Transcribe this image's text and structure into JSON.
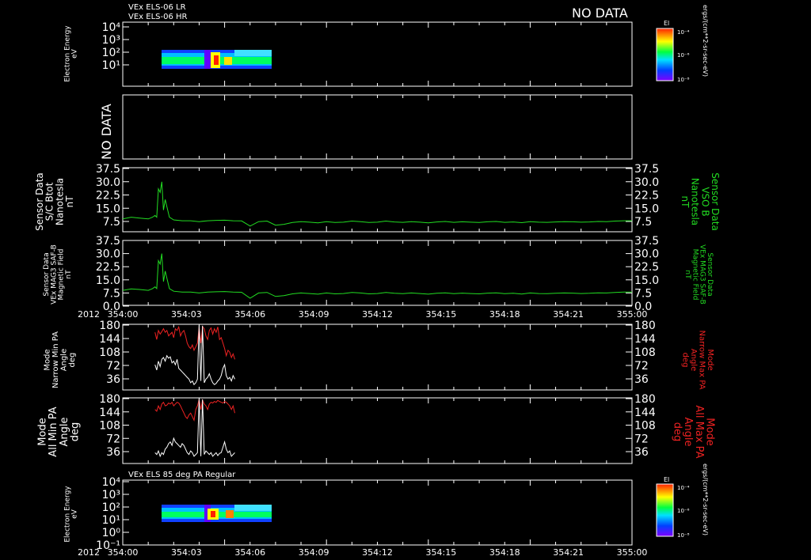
{
  "header": {
    "line1": "VEx ELS-06 LR",
    "line2": "VEx ELS-06 HR",
    "no_data": "NO DATA"
  },
  "colors": {
    "background": "#000000",
    "axes": "#ffffff",
    "green_trace": "#22dd22",
    "red_trace": "#ee2222",
    "white_trace": "#ffffff",
    "label_green": "#22dd22",
    "label_red": "#ee2222"
  },
  "time_axis": {
    "start": "354:00",
    "end": "355:00",
    "ticks": [
      "354:00",
      "354:03",
      "354:06",
      "354:09",
      "354:12",
      "354:15",
      "354:18",
      "354:21",
      "355:00"
    ],
    "year_label": "2012"
  },
  "panels": {
    "p1": {
      "ylabel": [
        "Electron Energy",
        "eV"
      ],
      "yticks": [
        "10⁴",
        "10³",
        "10²",
        "10¹"
      ],
      "colorbar_title": "El",
      "colorbar_ticks": [
        "10⁻⁴",
        "10⁻⁶",
        "10⁻⁸"
      ],
      "colorbar_units": "ergs/(cm**2-sr-sec-eV)"
    },
    "p2": {
      "no_data": "NO DATA"
    },
    "p3": {
      "left_label": [
        "Sensor Data",
        "S/C Btot",
        "Nanotesla",
        "nT"
      ],
      "right_label": [
        "Sensor Data",
        "VSO B",
        "Nanotesla",
        "nT"
      ],
      "yticks": [
        "37.5",
        "30.0",
        "22.5",
        "15.0",
        "7.5"
      ]
    },
    "p4": {
      "left_label": [
        "Sensor Data",
        "VEx MAG3 SAF-B",
        "Magnetic Field",
        "nT"
      ],
      "right_label": [
        "Sensor Data",
        "VEx MAG3 SAF-B",
        "Magnetic Field",
        "nT"
      ],
      "yticks": [
        "37.5",
        "30.0",
        "22.5",
        "15.0",
        "7.5",
        "0.0"
      ]
    },
    "p5": {
      "left_label": [
        "Mode",
        "Narrow Min PA",
        "Angle",
        "deg"
      ],
      "right_label": [
        "Mode",
        "Narrow Max PA",
        "Angle",
        "deg"
      ],
      "yticks": [
        "180",
        "144",
        "108",
        "72",
        "36"
      ]
    },
    "p6": {
      "left_label": [
        "Mode",
        "All Min PA",
        "Angle",
        "deg"
      ],
      "right_label": [
        "Mode",
        "All Max PA",
        "Angle",
        "deg"
      ],
      "yticks": [
        "180",
        "144",
        "108",
        "72",
        "36"
      ]
    },
    "p7": {
      "title": "VEx ELS 85 deg PA Regular",
      "ylabel": [
        "Electron Energy",
        "eV"
      ],
      "yticks": [
        "10⁴",
        "10³",
        "10²",
        "10¹",
        "10⁰",
        "10⁻¹"
      ],
      "colorbar_title": "El",
      "colorbar_ticks": [
        "10⁻⁴",
        "10⁻⁶",
        "10⁻⁸"
      ],
      "colorbar_units": "ergs/(cm**2-sr-sec-eV)"
    }
  },
  "chart_data": [
    {
      "type": "heatmap",
      "title": "VEx ELS-06 LR / VEx ELS-06 HR",
      "ylabel": "Electron Energy eV",
      "yscale": "log",
      "ylim": [
        1,
        10000
      ],
      "xlim": [
        "354:00",
        "355:00"
      ],
      "data_span": [
        "354:01.8",
        "354:06.9"
      ],
      "energy_range": [
        10,
        200
      ],
      "colorbar": {
        "title": "El",
        "scale": "log",
        "range": [
          1e-08,
          0.0001
        ],
        "units": "ergs/(cm**2-sr-sec-eV)"
      }
    },
    {
      "type": "line",
      "no_data": true,
      "label": "NO DATA"
    },
    {
      "type": "line",
      "ylabel": "Sensor Data S/C Btot Nanotesla nT",
      "ylim": [
        0,
        37.5
      ],
      "xlim_minutes": [
        0,
        60
      ],
      "series": [
        {
          "name": "VSO B",
          "color": "#22dd22",
          "x": [
            0,
            1,
            2,
            3,
            3.5,
            3.8,
            4.0,
            4.2,
            4.4,
            4.6,
            4.8,
            5.0,
            5.2,
            5.5,
            6,
            7,
            8,
            9,
            10,
            11,
            12,
            13,
            14,
            15,
            16,
            17,
            18,
            19,
            20,
            21,
            22,
            23,
            24,
            25,
            26,
            27,
            28,
            29,
            30,
            31,
            32,
            33,
            34,
            35,
            36,
            37,
            38,
            39,
            40,
            41,
            42,
            43,
            44,
            45,
            46,
            47,
            48,
            49,
            50,
            51,
            52,
            53,
            54,
            55,
            56,
            57,
            58,
            59,
            60
          ],
          "y": [
            9,
            10,
            9.5,
            9,
            10,
            11,
            10,
            26,
            24,
            30,
            14,
            20,
            16,
            10,
            8.5,
            8,
            8,
            7.5,
            8,
            8.2,
            8.3,
            8,
            7.9,
            5,
            7.5,
            7.8,
            5.5,
            6,
            7,
            7.5,
            7.2,
            6.8,
            7.5,
            7,
            7.2,
            7.8,
            7.5,
            7,
            7.2,
            7.8,
            7.3,
            7.1,
            7.5,
            7.2,
            6.8,
            7.3,
            7.6,
            7.1,
            7.4,
            7.2,
            7,
            7.4,
            7.6,
            7.1,
            7.3,
            6.9,
            7.5,
            7.2,
            7.1,
            7.3,
            7.5,
            7.4,
            7.2,
            7.3,
            7.6,
            7.5,
            7.8,
            8,
            8
          ]
        }
      ]
    },
    {
      "type": "line",
      "ylabel": "Sensor Data VEx MAG3 SAF-B Magnetic Field nT",
      "ylim": [
        0,
        37.5
      ],
      "xlim_minutes": [
        0,
        60
      ],
      "series": [
        {
          "name": "VEx MAG3 SAF-B",
          "color": "#22dd22",
          "x": [
            0,
            1,
            2,
            3,
            3.5,
            3.8,
            4.0,
            4.2,
            4.4,
            4.6,
            4.8,
            5.0,
            5.2,
            5.5,
            6,
            7,
            8,
            9,
            10,
            11,
            12,
            13,
            14,
            15,
            16,
            17,
            18,
            19,
            20,
            21,
            22,
            23,
            24,
            25,
            26,
            27,
            28,
            29,
            30,
            31,
            32,
            33,
            34,
            35,
            36,
            37,
            38,
            39,
            40,
            41,
            42,
            43,
            44,
            45,
            46,
            47,
            48,
            49,
            50,
            51,
            52,
            53,
            54,
            55,
            56,
            57,
            58,
            59,
            60
          ],
          "y": [
            9,
            9.8,
            9.5,
            9,
            10,
            11,
            10,
            26,
            24,
            30,
            14,
            20,
            16,
            10,
            8.5,
            8,
            8,
            7.5,
            8,
            8.2,
            8.3,
            8,
            7.9,
            4.5,
            7.5,
            7.8,
            5.5,
            6,
            7,
            7.5,
            7.2,
            6.8,
            7.5,
            7,
            7.2,
            7.8,
            7.5,
            7,
            7.2,
            7.8,
            7.3,
            7.1,
            7.5,
            7.2,
            6.8,
            7.3,
            7.6,
            7.1,
            7.4,
            7.2,
            7,
            7.4,
            7.6,
            7.1,
            7.3,
            6.9,
            7.5,
            7.2,
            7.1,
            7.3,
            7.5,
            7.4,
            7.2,
            7.3,
            7.6,
            7.5,
            7.8,
            8,
            8
          ]
        }
      ]
    },
    {
      "type": "line",
      "ylabel": "Mode Narrow Min PA Angle deg",
      "ylim": [
        0,
        180
      ],
      "xlim_minutes": [
        0,
        60
      ],
      "series": [
        {
          "name": "Narrow Max PA",
          "color": "#ee2222",
          "x": [
            3.8,
            4.0,
            4.2,
            4.4,
            4.6,
            4.8,
            5.0,
            5.2,
            5.4,
            5.6,
            5.8,
            6.0,
            6.2,
            6.4,
            6.6,
            6.8,
            7.0,
            7.2,
            7.4,
            7.6,
            7.8,
            8.0,
            8.2,
            8.4,
            8.6,
            8.8,
            9.0,
            9.2,
            9.4,
            9.6,
            9.8,
            10.0,
            10.2,
            10.4,
            10.6,
            10.8,
            11.0,
            11.2,
            11.4,
            11.6,
            11.8,
            12.0,
            12.2,
            12.4,
            12.6,
            12.8,
            13.0,
            13.2
          ],
          "y": [
            160,
            140,
            165,
            155,
            162,
            170,
            160,
            165,
            150,
            155,
            160,
            145,
            170,
            165,
            175,
            150,
            160,
            165,
            150,
            130,
            120,
            115,
            125,
            110,
            120,
            130,
            175,
            130,
            176,
            170,
            150,
            140,
            165,
            172,
            155,
            170,
            160,
            175,
            140,
            145,
            130,
            115,
            95,
            110,
            105,
            90,
            100,
            85
          ]
        },
        {
          "name": "Narrow Min PA",
          "color": "#ffffff",
          "x": [
            3.8,
            4.0,
            4.2,
            4.4,
            4.6,
            4.8,
            5.0,
            5.2,
            5.4,
            5.6,
            5.8,
            6.0,
            6.2,
            6.4,
            6.6,
            6.8,
            7.0,
            7.2,
            7.4,
            7.6,
            7.8,
            8.0,
            8.2,
            8.4,
            8.6,
            8.8,
            9.0,
            9.2,
            9.4,
            9.6,
            9.8,
            10.0,
            10.2,
            10.4,
            10.6,
            10.8,
            11.0,
            11.2,
            11.4,
            11.6,
            11.8,
            12.0,
            12.2,
            12.4,
            12.6,
            12.8,
            13.0,
            13.2
          ],
          "y": [
            70,
            55,
            80,
            65,
            85,
            90,
            80,
            95,
            88,
            92,
            75,
            80,
            70,
            85,
            60,
            55,
            50,
            45,
            40,
            35,
            30,
            20,
            25,
            15,
            20,
            30,
            180,
            25,
            178,
            20,
            30,
            35,
            45,
            30,
            20,
            15,
            18,
            25,
            30,
            40,
            60,
            70,
            40,
            30,
            35,
            25,
            40,
            30
          ]
        }
      ]
    },
    {
      "type": "line",
      "ylabel": "Mode All Min PA Angle deg",
      "ylim": [
        0,
        180
      ],
      "xlim_minutes": [
        0,
        60
      ],
      "series": [
        {
          "name": "All Max PA",
          "color": "#ee2222",
          "x": [
            3.8,
            4.0,
            4.2,
            4.4,
            4.6,
            4.8,
            5.0,
            5.2,
            5.4,
            5.6,
            5.8,
            6.0,
            6.2,
            6.4,
            6.6,
            6.8,
            7.0,
            7.2,
            7.4,
            7.6,
            7.8,
            8.0,
            8.2,
            8.4,
            8.6,
            8.8,
            9.0,
            9.2,
            9.4,
            9.6,
            9.8,
            10.0,
            10.2,
            10.4,
            10.6,
            10.8,
            11.0,
            11.2,
            11.4,
            11.6,
            11.8,
            12.0,
            12.2,
            12.4,
            12.6,
            12.8,
            13.0,
            13.2
          ],
          "y": [
            150,
            145,
            160,
            150,
            165,
            170,
            160,
            162,
            168,
            165,
            170,
            160,
            165,
            170,
            168,
            160,
            150,
            140,
            130,
            125,
            135,
            140,
            130,
            120,
            150,
            160,
            178,
            150,
            176,
            165,
            160,
            150,
            165,
            170,
            168,
            172,
            170,
            175,
            172,
            170,
            168,
            172,
            170,
            165,
            160,
            150,
            160,
            140
          ]
        },
        {
          "name": "All Min PA",
          "color": "#ffffff",
          "x": [
            3.8,
            4.0,
            4.2,
            4.4,
            4.6,
            4.8,
            5.0,
            5.2,
            5.4,
            5.6,
            5.8,
            6.0,
            6.2,
            6.4,
            6.6,
            6.8,
            7.0,
            7.2,
            7.4,
            7.6,
            7.8,
            8.0,
            8.2,
            8.4,
            8.6,
            8.8,
            9.0,
            9.2,
            9.4,
            9.6,
            9.8,
            10.0,
            10.2,
            10.4,
            10.6,
            10.8,
            11.0,
            11.2,
            11.4,
            11.6,
            11.8,
            12.0,
            12.2,
            12.4,
            12.6,
            12.8,
            13.0,
            13.2
          ],
          "y": [
            30,
            25,
            35,
            20,
            30,
            25,
            40,
            45,
            55,
            60,
            50,
            70,
            60,
            55,
            50,
            45,
            55,
            50,
            40,
            30,
            25,
            35,
            30,
            20,
            25,
            30,
            180,
            20,
            178,
            25,
            35,
            30,
            25,
            30,
            20,
            25,
            30,
            22,
            28,
            30,
            45,
            60,
            40,
            30,
            35,
            20,
            25,
            30
          ]
        }
      ]
    },
    {
      "type": "heatmap",
      "title": "VEx ELS 85 deg PA Regular",
      "ylabel": "Electron Energy eV",
      "yscale": "log",
      "ylim": [
        0.1,
        10000
      ],
      "xlim": [
        "354:00",
        "355:00"
      ],
      "data_span": [
        "354:01.8",
        "354:06.9"
      ],
      "energy_range": [
        10,
        200
      ],
      "colorbar": {
        "title": "El",
        "scale": "log",
        "range": [
          1e-08,
          0.0001
        ],
        "units": "ergs/(cm**2-sr-sec-eV)"
      }
    }
  ]
}
